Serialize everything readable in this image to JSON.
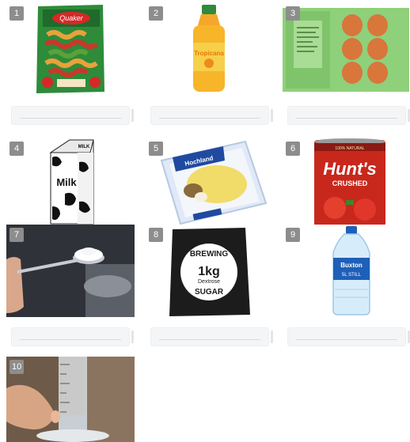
{
  "items": [
    {
      "num": "1",
      "image": "pasta-bag",
      "pack_text": "Quaker"
    },
    {
      "num": "2",
      "image": "orange-juice-bottle",
      "pack_text": "Tropicana"
    },
    {
      "num": "3",
      "image": "egg-carton",
      "pack_text": ""
    },
    {
      "num": "4",
      "image": "milk-carton",
      "pack_text": "Milk",
      "pack_text2": "MILK"
    },
    {
      "num": "5",
      "image": "cheese-slices",
      "pack_text": "Hochland"
    },
    {
      "num": "6",
      "image": "tomato-can",
      "pack_text": "Hunt's",
      "pack_text2": "CRUSHED",
      "pack_text3": "100% NATURAL"
    },
    {
      "num": "7",
      "image": "measuring-spoon-salt",
      "pack_text": ""
    },
    {
      "num": "8",
      "image": "sugar-bag",
      "pack_text": "BREWING",
      "pack_text2": "1kg",
      "pack_text3": "Dextrose",
      "pack_text4": "SUGAR"
    },
    {
      "num": "9",
      "image": "water-bottle",
      "pack_text": "Buxton",
      "pack_text2": "5L STILL"
    },
    {
      "num": "10",
      "image": "measuring-cylinder",
      "pack_text": ""
    }
  ],
  "answer_fields": [
    {
      "value": ""
    },
    {
      "value": ""
    },
    {
      "value": ""
    },
    {
      "value": ""
    },
    {
      "value": ""
    },
    {
      "value": ""
    },
    {
      "value": ""
    },
    {
      "value": ""
    },
    {
      "value": ""
    }
  ]
}
